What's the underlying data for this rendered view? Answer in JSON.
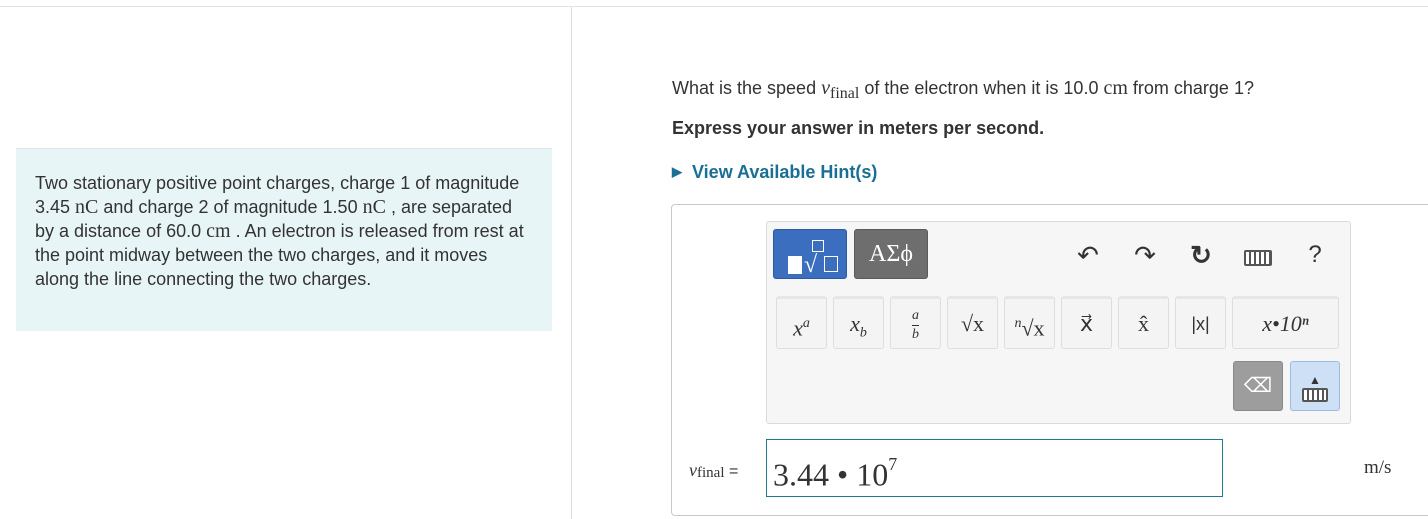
{
  "problem": {
    "part1": "Two stationary positive point charges, charge 1 of magnitude 3.45 ",
    "unit_nC_1": "nC",
    "part2": " and charge 2 of magnitude 1.50 ",
    "unit_nC_2": "nC",
    "part3": " , are separated by a distance of 60.0 ",
    "unit_cm": "cm",
    "part4": " . An electron is released from rest at the point midway between the two charges, and it moves along the line connecting the two charges."
  },
  "question": {
    "pre": "What is the speed ",
    "var": "v",
    "var_sub": "final",
    "mid": " of the electron when it is 10.0 ",
    "unit": "cm",
    "post": " from charge 1?"
  },
  "instruction": "Express your answer in meters per second.",
  "hint": "View Available Hint(s)",
  "toolbar": {
    "greek_tab": "ΑΣϕ",
    "undo": "↶",
    "redo": "↷",
    "reset": "↻",
    "help": "?",
    "keys": {
      "superscript_base": "x",
      "superscript_exp": "a",
      "subscript_base": "x",
      "subscript_sub": "b",
      "frac_num": "a",
      "frac_den": "b",
      "sqrt": "√x",
      "nthroot_n": "n",
      "nthroot": "√x",
      "vector": "x⃗",
      "unit_vector": "x̂",
      "abs": "|x|",
      "sci": "x•10ⁿ"
    },
    "delete": "⌫"
  },
  "answer": {
    "label_var": "v",
    "label_sub": "final",
    "label_eq": " =",
    "value_mantissa": "3.44 • 10",
    "value_exp": "7",
    "unit": "m/s"
  }
}
